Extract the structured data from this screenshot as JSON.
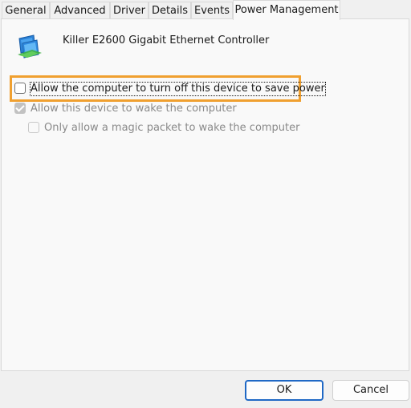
{
  "tabs": [
    {
      "label": "General"
    },
    {
      "label": "Advanced"
    },
    {
      "label": "Driver"
    },
    {
      "label": "Details"
    },
    {
      "label": "Events"
    },
    {
      "label": "Power Management",
      "active": true
    }
  ],
  "device": {
    "icon": "network-adapter-icon",
    "name": "Killer E2600 Gigabit Ethernet Controller"
  },
  "options": [
    {
      "label": "Allow the computer to turn off this device to save power",
      "checked": false,
      "enabled": true,
      "focused": true
    },
    {
      "label": "Allow this device to wake the computer",
      "checked": true,
      "enabled": false
    },
    {
      "label": "Only allow a magic packet to wake the computer",
      "checked": false,
      "enabled": false
    }
  ],
  "buttons": {
    "ok_label": "OK",
    "cancel_label": "Cancel"
  },
  "colors": {
    "highlight": "#f0a030",
    "default_button_border": "#1f68c5"
  }
}
